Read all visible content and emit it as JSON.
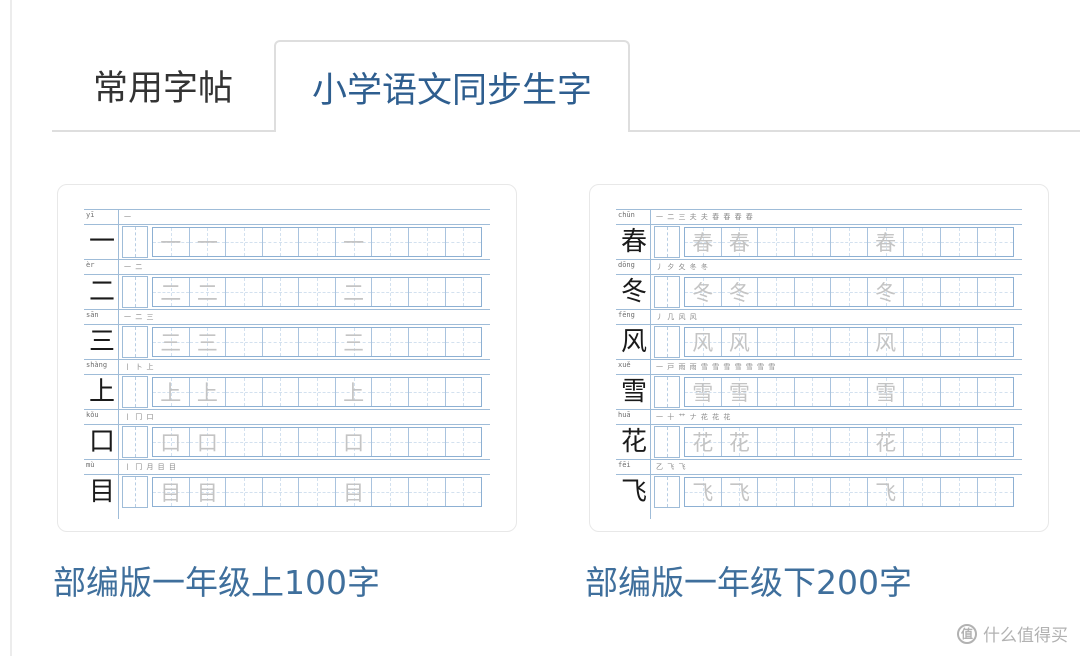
{
  "tabs": [
    {
      "label": "常用字帖",
      "active": false
    },
    {
      "label": "小学语文同步生字",
      "active": true
    }
  ],
  "cards": [
    {
      "title": "部编版一年级上100字",
      "rows": [
        {
          "pinyin": "yī",
          "char": "一",
          "strokes": "一",
          "copies": [
            "一",
            "一",
            "",
            "",
            "",
            "一",
            "",
            "",
            ""
          ]
        },
        {
          "pinyin": "èr",
          "char": "二",
          "strokes": "一 二",
          "copies": [
            "二",
            "二",
            "",
            "",
            "",
            "二",
            "",
            "",
            ""
          ]
        },
        {
          "pinyin": "sān",
          "char": "三",
          "strokes": "一 二 三",
          "copies": [
            "三",
            "三",
            "",
            "",
            "",
            "三",
            "",
            "",
            ""
          ]
        },
        {
          "pinyin": "shàng",
          "char": "上",
          "strokes": "丨 卜 上",
          "copies": [
            "上",
            "上",
            "",
            "",
            "",
            "上",
            "",
            "",
            ""
          ]
        },
        {
          "pinyin": "kǒu",
          "char": "口",
          "strokes": "丨 冂 口",
          "copies": [
            "口",
            "口",
            "",
            "",
            "",
            "口",
            "",
            "",
            ""
          ]
        },
        {
          "pinyin": "mù",
          "char": "目",
          "strokes": "丨 冂 月 目 目",
          "copies": [
            "目",
            "目",
            "",
            "",
            "",
            "目",
            "",
            "",
            ""
          ]
        }
      ]
    },
    {
      "title": "部编版一年级下200字",
      "rows": [
        {
          "pinyin": "chūn",
          "char": "春",
          "strokes": "一 二 三 夫 夫 春 春 春 春",
          "copies": [
            "春",
            "春",
            "",
            "",
            "",
            "春",
            "",
            "",
            ""
          ]
        },
        {
          "pinyin": "dōng",
          "char": "冬",
          "strokes": "丿 夕 夂 冬 冬",
          "copies": [
            "冬",
            "冬",
            "",
            "",
            "",
            "冬",
            "",
            "",
            ""
          ]
        },
        {
          "pinyin": "fēng",
          "char": "风",
          "strokes": "丿 几 风 风",
          "copies": [
            "风",
            "风",
            "",
            "",
            "",
            "风",
            "",
            "",
            ""
          ]
        },
        {
          "pinyin": "xuě",
          "char": "雪",
          "strokes": "一 戸 雨 雨 雪 雪 雪 雪 雪 雪 雪",
          "copies": [
            "雪",
            "雪",
            "",
            "",
            "",
            "雪",
            "",
            "",
            ""
          ]
        },
        {
          "pinyin": "huā",
          "char": "花",
          "strokes": "一 十 艹 ナ 花 花 花",
          "copies": [
            "花",
            "花",
            "",
            "",
            "",
            "花",
            "",
            "",
            ""
          ]
        },
        {
          "pinyin": "fēi",
          "char": "飞",
          "strokes": "乙 飞 飞",
          "copies": [
            "飞",
            "飞",
            "",
            "",
            "",
            "飞",
            "",
            "",
            ""
          ]
        }
      ]
    }
  ],
  "watermark": {
    "text": "什么值得买",
    "icon": "zhi-logo-icon"
  }
}
